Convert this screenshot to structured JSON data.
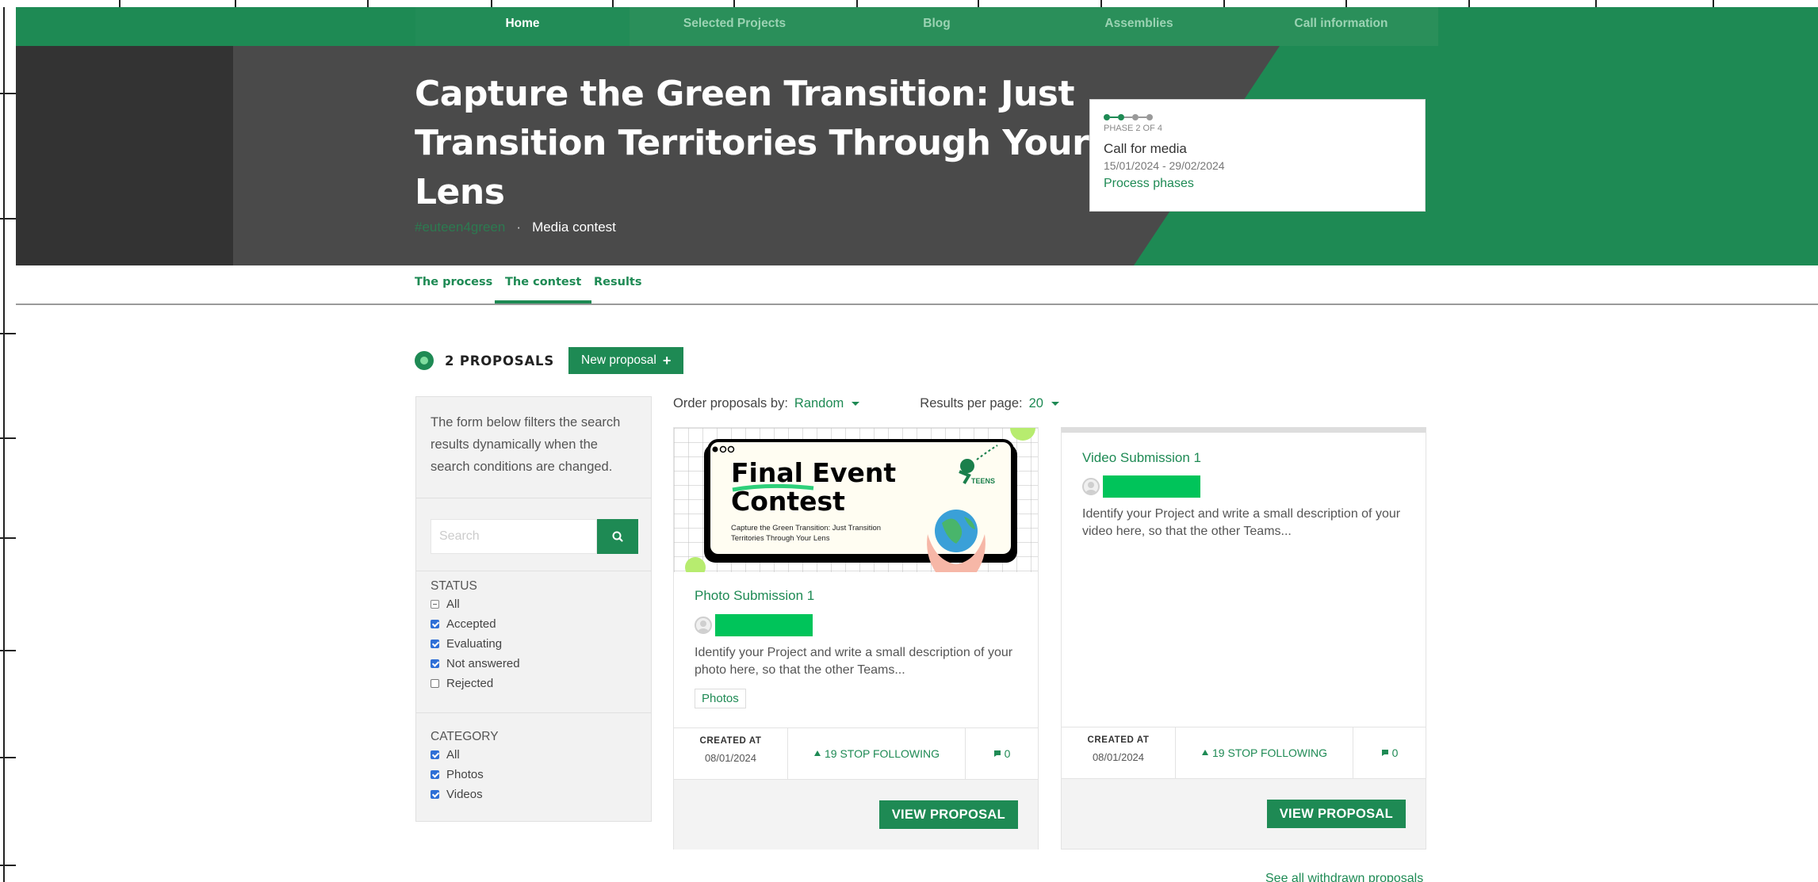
{
  "nav": {
    "items": [
      {
        "label": "Home",
        "active": true
      },
      {
        "label": "Selected Projects",
        "active": false
      },
      {
        "label": "Blog",
        "active": false
      },
      {
        "label": "Assemblies",
        "active": false
      },
      {
        "label": "Call information",
        "active": false
      }
    ]
  },
  "hero": {
    "title": "Capture the Green Transition: Just Transition Territories Through Your Lens",
    "hashtag": "#euteen4green",
    "separator": "·",
    "type_label": "Media contest"
  },
  "phase": {
    "label": "PHASE 2 OF 4",
    "title": "Call for media",
    "dates": "15/01/2024 - 29/02/2024",
    "link": "Process phases",
    "current": 2,
    "total": 4
  },
  "tabs": [
    {
      "label": "The process",
      "active": false
    },
    {
      "label": "The contest",
      "active": true
    },
    {
      "label": "Results",
      "active": false
    }
  ],
  "proposals_header": {
    "count_label": "2 PROPOSALS",
    "new_button": "New proposal"
  },
  "filter": {
    "intro": "The form below filters the search results dynamically when the search conditions are changed.",
    "search_placeholder": "Search",
    "status": {
      "title": "STATUS",
      "options": [
        {
          "label": "All",
          "state": "indeterminate"
        },
        {
          "label": "Accepted",
          "state": "checked"
        },
        {
          "label": "Evaluating",
          "state": "checked"
        },
        {
          "label": "Not answered",
          "state": "checked"
        },
        {
          "label": "Rejected",
          "state": "unchecked"
        }
      ]
    },
    "category": {
      "title": "CATEGORY",
      "options": [
        {
          "label": "All",
          "state": "checked"
        },
        {
          "label": "Photos",
          "state": "checked"
        },
        {
          "label": "Videos",
          "state": "checked"
        }
      ]
    }
  },
  "order": {
    "order_label": "Order proposals by:",
    "order_value": "Random",
    "per_page_label": "Results per page:",
    "per_page_value": "20"
  },
  "cards": [
    {
      "title": "Photo Submission 1",
      "description": "Identify your Project and write a small description of your photo here, so that the other Teams...",
      "tag": "Photos",
      "created_label": "CREATED AT",
      "created_value": "08/01/2024",
      "follow": "19 STOP FOLLOWING",
      "comments": "0",
      "button": "VIEW PROPOSAL",
      "image": {
        "heading_line1": "Final Event",
        "heading_line2": "Contest",
        "caption": "Capture the Green Transition: Just Transition Territories Through Your Lens",
        "logo_text": "TEENS"
      }
    },
    {
      "title": "Video Submission 1",
      "description": "Identify your Project and write a small description of your video here, so that the other Teams...",
      "created_label": "CREATED AT",
      "created_value": "08/01/2024",
      "follow": "19 STOP FOLLOWING",
      "comments": "0",
      "button": "VIEW PROPOSAL"
    }
  ],
  "withdrawn_link": "See all withdrawn proposals",
  "colors": {
    "brand_green": "#1e8a54",
    "author_highlight": "#00c45a",
    "hero_dark": "#4a4a4a",
    "checkbox_blue": "#2f6fd6"
  }
}
